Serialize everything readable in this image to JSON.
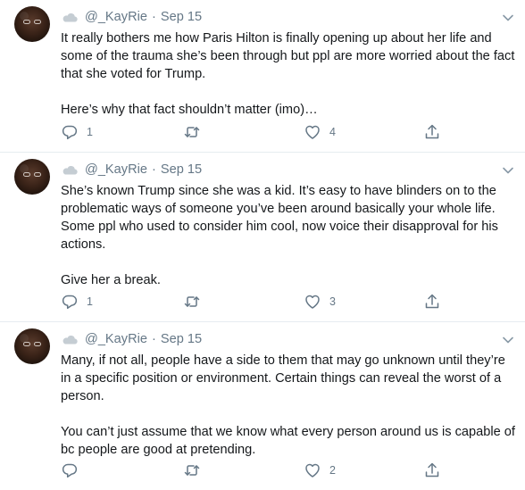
{
  "tweets": [
    {
      "handle": "@_KayRie",
      "separator": "·",
      "date": "Sep 15",
      "paragraphs": [
        "It really bothers me how Paris Hilton is finally opening up about her life and some of the trauma she’s been through but ppl are more worried about the fact that she voted for Trump.",
        "Here’s why that fact shouldn’t matter (imo)…"
      ],
      "reply_count": "1",
      "retweet_count": "",
      "like_count": "4"
    },
    {
      "handle": "@_KayRie",
      "separator": "·",
      "date": "Sep 15",
      "paragraphs": [
        "She’s known Trump since she was a kid. It’s easy to have blinders on to the problematic ways of someone you’ve been around basically your whole life. Some ppl who used to consider him cool, now voice their disapproval for his actions.",
        "Give her a break."
      ],
      "reply_count": "1",
      "retweet_count": "",
      "like_count": "3"
    },
    {
      "handle": "@_KayRie",
      "separator": "·",
      "date": "Sep 15",
      "paragraphs": [
        "Many, if not all, people have a side to them that may go unknown until they’re in a specific position or environment. Certain things can reveal the worst of a person.",
        "You can’t just assume that we know what every person around us is capable of bc people are good at pretending."
      ],
      "reply_count": "",
      "retweet_count": "",
      "like_count": "2"
    }
  ],
  "icons": {
    "avatar": "avatar",
    "cloud": "cloud-icon",
    "caret": "chevron-down-icon",
    "reply": "reply-icon",
    "retweet": "retweet-icon",
    "like": "heart-icon",
    "share": "share-icon"
  },
  "colors": {
    "secondary_text": "#657786",
    "divider": "#e6ecf0",
    "text": "#14171a"
  }
}
